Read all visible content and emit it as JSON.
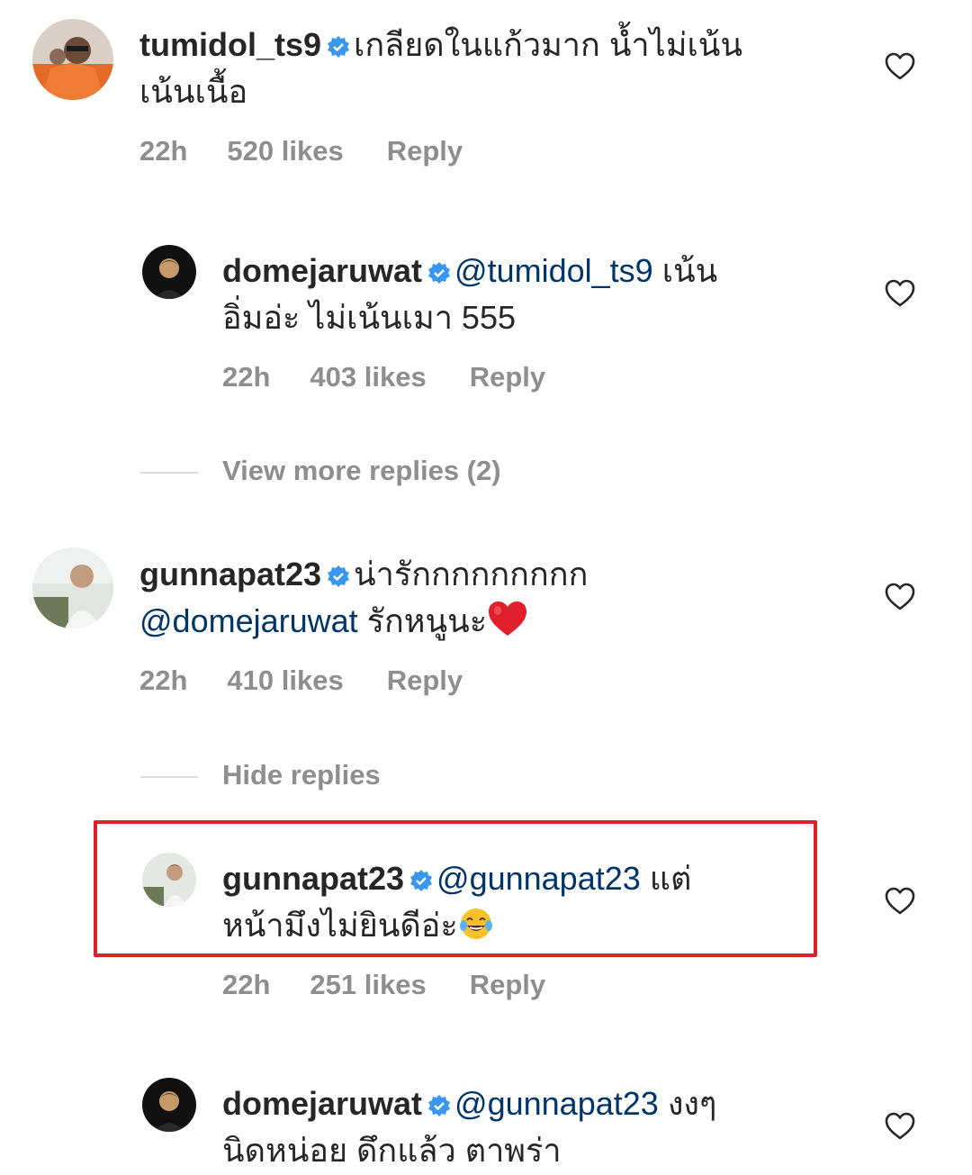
{
  "comments": [
    {
      "username": "tumidol_ts9",
      "text": "เกลียดในแก้วมาก น้ำไม่เน้น",
      "text_line2": "เน้นเนื้อ",
      "time": "22h",
      "likes": "520 likes",
      "reply": "Reply",
      "avatar": "avatar-orange-shirt"
    },
    {
      "username": "domejaruwat",
      "mention": "@tumidol_ts9",
      "text": "เน้น",
      "text_line2": "อิ่มอ่ะ ไม่เน้นเมา 555",
      "time": "22h",
      "likes": "403 likes",
      "reply": "Reply",
      "avatar": "avatar-dark"
    },
    {
      "username": "gunnapat23",
      "text": "น่ารักกกกกกกกก",
      "mention_line2": "@domejaruwat",
      "text_line2": "รักหนูนะ",
      "emoji": "red-heart",
      "time": "22h",
      "likes": "410 likes",
      "reply": "Reply",
      "avatar": "avatar-man-outdoors"
    },
    {
      "username": "gunnapat23",
      "mention": "@gunnapat23",
      "text": "แต่",
      "text_line2": "หน้ามึงไม่ยินดีอ่ะ",
      "emoji": "tears-of-joy",
      "time": "22h",
      "likes": "251 likes",
      "reply": "Reply",
      "highlighted": true,
      "highlight_color": "#d9232d",
      "avatar": "avatar-man-outdoors"
    },
    {
      "username": "domejaruwat",
      "mention": "@gunnapat23",
      "text": "งงๆ",
      "text_line2": "นิดหน่อย ดึกแล้ว ตาพร่า",
      "avatar": "avatar-dark"
    }
  ],
  "thread_controls": {
    "view_more": "View more replies (2)",
    "hide": "Hide replies"
  },
  "colors": {
    "verified": "#3897f0",
    "mention": "#003569",
    "meta": "#8e8e8e"
  },
  "icons": {
    "like": "heart-outline-icon",
    "verified": "verified-badge-icon"
  }
}
